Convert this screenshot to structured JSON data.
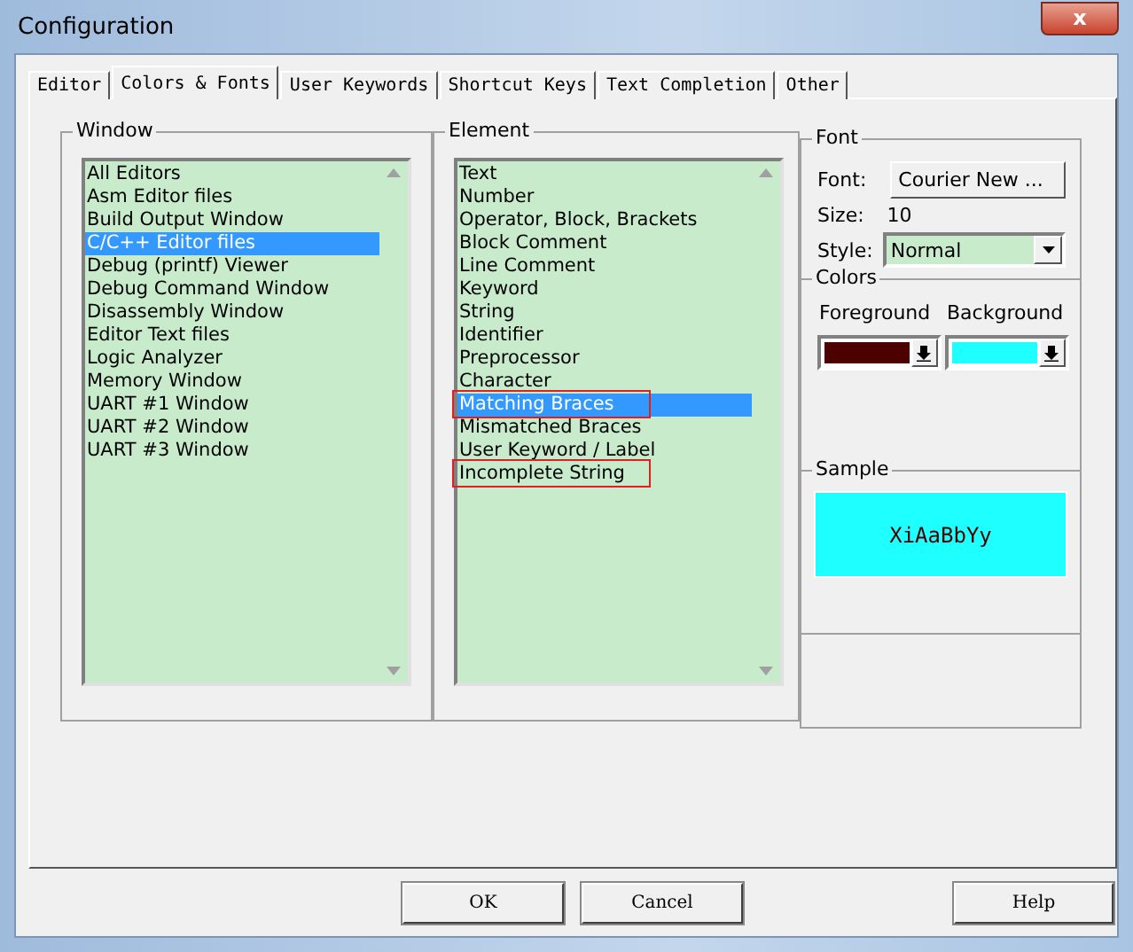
{
  "window": {
    "title": "Configuration",
    "close_button": "x"
  },
  "tabs": [
    {
      "label": "Editor",
      "selected": false
    },
    {
      "label": "Colors & Fonts",
      "selected": true
    },
    {
      "label": "User Keywords",
      "selected": false
    },
    {
      "label": "Shortcut Keys",
      "selected": false
    },
    {
      "label": "Text Completion",
      "selected": false
    },
    {
      "label": "Other",
      "selected": false
    }
  ],
  "window_group": {
    "title": "Window",
    "items": [
      {
        "label": "All Editors",
        "selected": false
      },
      {
        "label": "Asm Editor files",
        "selected": false
      },
      {
        "label": "Build Output Window",
        "selected": false
      },
      {
        "label": "C/C++ Editor files",
        "selected": true
      },
      {
        "label": "Debug (printf) Viewer",
        "selected": false
      },
      {
        "label": "Debug Command Window",
        "selected": false
      },
      {
        "label": "Disassembly Window",
        "selected": false
      },
      {
        "label": "Editor Text files",
        "selected": false
      },
      {
        "label": "Logic Analyzer",
        "selected": false
      },
      {
        "label": "Memory Window",
        "selected": false
      },
      {
        "label": "UART #1 Window",
        "selected": false
      },
      {
        "label": "UART #2 Window",
        "selected": false
      },
      {
        "label": "UART #3 Window",
        "selected": false
      }
    ]
  },
  "element_group": {
    "title": "Element",
    "items": [
      {
        "label": "Text",
        "selected": false,
        "marked": false
      },
      {
        "label": "Number",
        "selected": false,
        "marked": false
      },
      {
        "label": "Operator, Block, Brackets",
        "selected": false,
        "marked": false
      },
      {
        "label": "Block Comment",
        "selected": false,
        "marked": false
      },
      {
        "label": "Line Comment",
        "selected": false,
        "marked": false
      },
      {
        "label": "Keyword",
        "selected": false,
        "marked": false
      },
      {
        "label": "String",
        "selected": false,
        "marked": false
      },
      {
        "label": "Identifier",
        "selected": false,
        "marked": false
      },
      {
        "label": "Preprocessor",
        "selected": false,
        "marked": false
      },
      {
        "label": "Character",
        "selected": false,
        "marked": false
      },
      {
        "label": "Matching Braces",
        "selected": true,
        "marked": true
      },
      {
        "label": "Mismatched Braces",
        "selected": false,
        "marked": false
      },
      {
        "label": "User Keyword / Label",
        "selected": false,
        "marked": false
      },
      {
        "label": "Incomplete String",
        "selected": false,
        "marked": true
      }
    ]
  },
  "font_group": {
    "title": "Font",
    "font_label": "Font:",
    "font_button": "Courier New ...",
    "size_label": "Size:",
    "size_value": "10",
    "style_label": "Style:",
    "style_value": "Normal"
  },
  "colors_group": {
    "title": "Colors",
    "swatches": [
      {
        "label": "Foreground",
        "color": "#4d0000"
      },
      {
        "label": "Background",
        "color": "#1effff"
      }
    ]
  },
  "sample_group": {
    "title": "Sample",
    "text": "XiAaBbYy"
  },
  "buttons": [
    "OK",
    "Cancel",
    "Help"
  ]
}
